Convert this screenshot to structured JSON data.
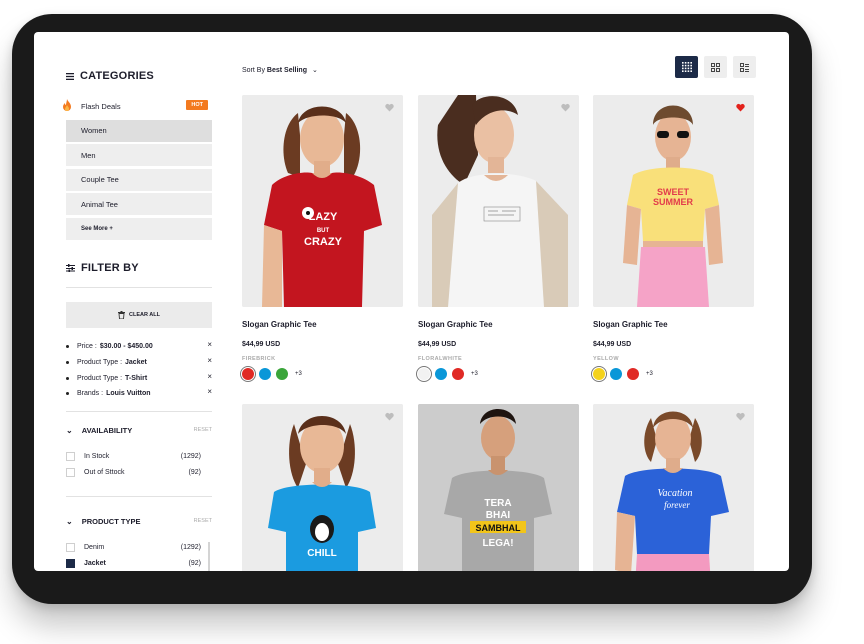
{
  "categories": {
    "title": "CATEGORIES",
    "items": [
      {
        "label": "Flash Deals",
        "badge": "HOT"
      },
      {
        "label": "Women"
      },
      {
        "label": "Men"
      },
      {
        "label": "Couple Tee"
      },
      {
        "label": "Animal Tee"
      },
      {
        "label": "See More +"
      }
    ]
  },
  "filter": {
    "title": "FILTER BY",
    "clear_label": "CLEAR ALL",
    "active": [
      {
        "key": "Price :",
        "value": "$30.00 - $450.00"
      },
      {
        "key": "Product Type :",
        "value": "Jacket"
      },
      {
        "key": "Product Type :",
        "value": "T-Shirt"
      },
      {
        "key": "Brands :",
        "value": "Louis Vuitton"
      }
    ],
    "remove_glyph": "×"
  },
  "availability": {
    "title": "AVAILABILITY",
    "reset": "RESET",
    "options": [
      {
        "label": "In Stock",
        "count": "(1292)",
        "checked": false
      },
      {
        "label": "Out of Sttock",
        "count": "(92)",
        "checked": false
      }
    ]
  },
  "product_type": {
    "title": "PRODUCT TYPE",
    "reset": "RESET",
    "options": [
      {
        "label": "Denim",
        "count": "(1292)",
        "checked": false
      },
      {
        "label": "Jacket",
        "count": "(92)",
        "checked": true
      }
    ]
  },
  "sort": {
    "prefix": "Sort By",
    "value": "Best Selling",
    "chevron": "⌄"
  },
  "view_modes": [
    "grid-4-icon",
    "grid-2-icon",
    "list-icon"
  ],
  "products": [
    {
      "name": "Slogan Graphic Tee",
      "price": "$44,99 USD",
      "color_name": "FIREBRICK",
      "swatches": [
        "#e02a25",
        "#0a97d8",
        "#3aa53a"
      ],
      "more": "+3",
      "wishlisted": false,
      "shirt": "#c3151f",
      "print": "LAZY BUT CRAZY"
    },
    {
      "name": "Slogan Graphic Tee",
      "price": "$44,99 USD",
      "color_name": "FLORALWHITE",
      "swatches": [
        "#f2f2f2",
        "#0a97d8",
        "#e02a25"
      ],
      "more": "+3",
      "wishlisted": false,
      "shirt": "#f4f4f4",
      "print": ""
    },
    {
      "name": "Slogan Graphic Tee",
      "price": "$44,99 USD",
      "color_name": "YELLOW",
      "swatches": [
        "#f4d21c",
        "#0a97d8",
        "#e02a25"
      ],
      "more": "+3",
      "wishlisted": true,
      "shirt": "#f9e07a",
      "print": "SWEET SUMMER"
    },
    {
      "name": "",
      "price": "",
      "color_name": "",
      "swatches": [],
      "more": "",
      "wishlisted": false,
      "shirt": "#1b9be0",
      "print": "CHILL"
    },
    {
      "name": "",
      "price": "",
      "color_name": "",
      "swatches": [],
      "more": "",
      "wishlisted": false,
      "shirt": "#a9a9a9",
      "print": "TERA BHAI SAMBHAL LEGA!"
    },
    {
      "name": "",
      "price": "",
      "color_name": "",
      "swatches": [],
      "more": "",
      "wishlisted": false,
      "shirt": "#2b62d8",
      "print": "Vacation forever"
    }
  ],
  "colors": {
    "accent": "#f37a1f",
    "navy": "#1c2a47",
    "heart_active": "#e3221c",
    "heart_idle": "#bdbdbd"
  }
}
